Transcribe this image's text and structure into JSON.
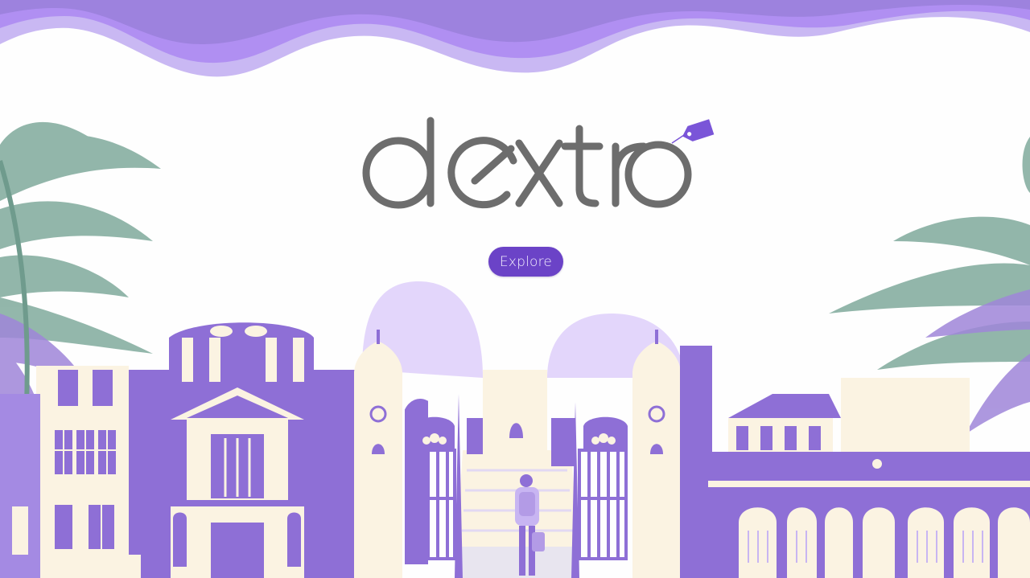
{
  "brand": {
    "name": "dextro",
    "accent": "#6b43c7",
    "logo_color": "#6d6d6d",
    "tag_color": "#7a55d8"
  },
  "hero": {
    "cta_label": "Explore"
  },
  "palette": {
    "lavender": "#b39be6",
    "purple": "#8e6fd6",
    "deep_purple": "#7a5ccc",
    "cream": "#fbf3e2",
    "palm_green": "#7fa99a"
  }
}
